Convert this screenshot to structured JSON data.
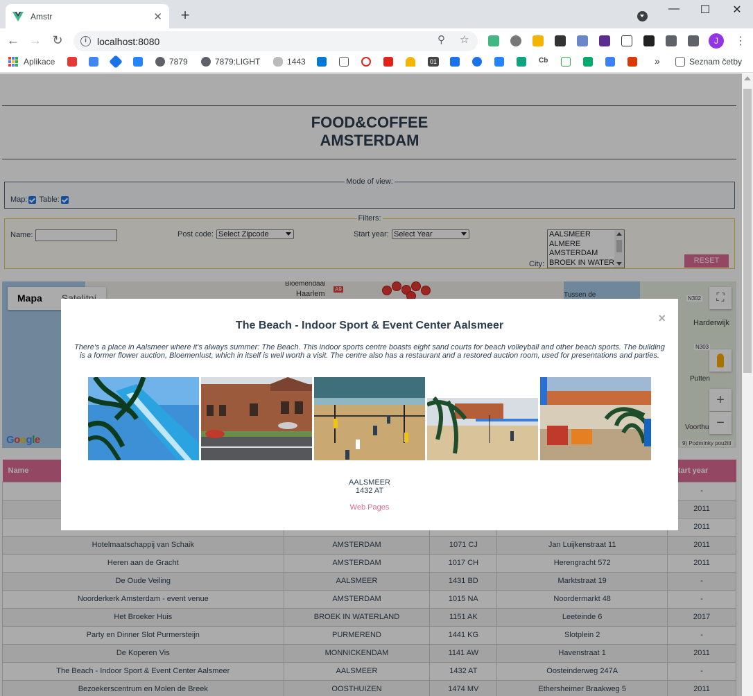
{
  "browser": {
    "tab_title": "Amstr",
    "url": "localhost:8080",
    "avatar_letter": "J",
    "bookmarks": [
      "Aplikace",
      "7879",
      "7879:LIGHT",
      "1443",
      "01",
      "Cb",
      "Seznam četby"
    ],
    "overflow": "»"
  },
  "page": {
    "title_line1": "FOOD&COFFEE",
    "title_line2": "AMSTERDAM",
    "mode_legend": "Mode of view:",
    "mode_map_label": "Map:",
    "mode_table_label": "Table:",
    "filters_legend": "Filters:",
    "name_label": "Name:",
    "postcode_label": "Post code:",
    "postcode_value": "Select Zipcode",
    "startyear_label": "Start year:",
    "startyear_value": "Select Year",
    "city_label": "City:",
    "city_options": [
      "AALSMEER",
      "ALMERE",
      "AMSTERDAM",
      "BROEK IN WATER"
    ],
    "reset_label": "RESET"
  },
  "map": {
    "type_map": "Mapa",
    "type_satellite": "Satelitní",
    "place_haarlem": "Haarlem",
    "place_harderwijk": "Harderwijk",
    "place_putten": "Putten",
    "place_voorthuizen": "Voorthui",
    "place_bloemendaal": "Bloemendaal",
    "place_tussen": "Tussen de",
    "road_a9": "A9",
    "road_n302": "N302",
    "road_n303": "N303",
    "logo": "Google",
    "terms": "9) Podmínky použití",
    "zoom_in": "+",
    "zoom_out": "−"
  },
  "table": {
    "headers": [
      "Name",
      "",
      "",
      "",
      "Start year"
    ],
    "rows": [
      [
        "",
        "",
        "",
        "",
        "-"
      ],
      [
        "",
        "",
        "",
        "",
        "2011"
      ],
      [
        "",
        "",
        "",
        "",
        "2011"
      ],
      [
        "Hotelmaatschappij van Schaik",
        "AMSTERDAM",
        "1071 CJ",
        "Jan Luijkenstraat 11",
        "2011"
      ],
      [
        "Heren aan de Gracht",
        "AMSTERDAM",
        "1017 CH",
        "Herengracht 572",
        "2011"
      ],
      [
        "De Oude Veiling",
        "AALSMEER",
        "1431 BD",
        "Marktstraat 19",
        "-"
      ],
      [
        "Noorderkerk Amsterdam - event venue",
        "AMSTERDAM",
        "1015 NA",
        "Noordermarkt 48",
        "-"
      ],
      [
        "Het Broeker Huis",
        "BROEK IN WATERLAND",
        "1151 AK",
        "Leeteinde 6",
        "2017"
      ],
      [
        "Party en Dinner Slot Purmersteijn",
        "PURMEREND",
        "1441 KG",
        "Slotplein 2",
        "-"
      ],
      [
        "De Koperen Vis",
        "MONNICKENDAM",
        "1141 AW",
        "Havenstraat 1",
        "2011"
      ],
      [
        "The Beach - Indoor Sport & Event Center Aalsmeer",
        "AALSMEER",
        "1432 AT",
        "Oosteinderweg 247A",
        "-"
      ],
      [
        "Bezoekerscentrum en Molen de Breek",
        "OOSTHUIZEN",
        "1474 MV",
        "Ethersheimer Braakweg 5",
        "2011"
      ]
    ]
  },
  "modal": {
    "close": "×",
    "title": "The Beach - Indoor Sport & Event Center Aalsmeer",
    "description": "There's a place in Aalsmeer where it's always summer: The Beach. This indoor sports centre boasts eight sand courts for beach volleyball and other beach sports. The building is a former flower auction, Bloemenlust, which in itself is well worth a visit. The centre also has a restaurant and a restored auction room, used for presentations and parties.",
    "city": "AALSMEER",
    "postcode": "1432 AT",
    "web_link": "Web Pages"
  },
  "colors": {
    "accent": "#dc6b93",
    "title": "#2c3e50",
    "filters_border": "#e7c84a"
  }
}
